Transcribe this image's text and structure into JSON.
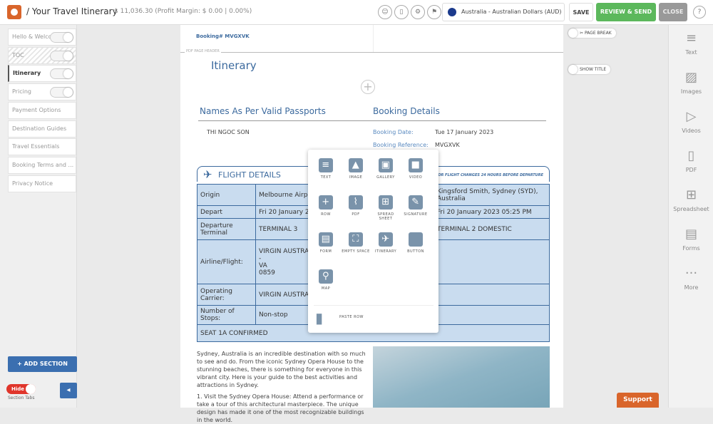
{
  "header": {
    "title": "/ Your Travel Itinerary",
    "price": "$ 11,036.30 (Profit Margin:  $ 0.00 | 0.00%)",
    "currency": "Australia - Australian Dollars (AUD)",
    "save": "SAVE",
    "review": "REVIEW & SEND",
    "close": "CLOSE",
    "help": "?"
  },
  "sidebar": {
    "items": [
      {
        "label": "Hello & Welcome"
      },
      {
        "label": "TOC"
      },
      {
        "label": "Itinerary"
      },
      {
        "label": "Pricing"
      },
      {
        "label": "Payment Options"
      },
      {
        "label": "Destination Guides"
      },
      {
        "label": "Travel Essentials"
      },
      {
        "label": "Booking Terms and ..."
      },
      {
        "label": "Privacy Notice"
      }
    ],
    "add_section": "+ ADD SECTION",
    "hide": "Hide",
    "section_tabs": "Section Tabs"
  },
  "page": {
    "booking_no": "Booking# MVGXVK",
    "pdf_header": "PDF PAGE HEADER",
    "title": "Itinerary",
    "names_heading": "Names As Per Valid Passports",
    "booking_heading": "Booking Details",
    "passenger": "THI NGOC SON",
    "booking_date_label": "Booking Date:",
    "booking_date": "Tue 17 January 2023",
    "booking_ref_label": "Booking Reference:",
    "booking_ref": "MVGXVK",
    "page_break": "PAGE BREAK",
    "show_title": "SHOW TITLE"
  },
  "flight": {
    "title": "FLIGHT DETAILS",
    "note": "FOR FLIGHT CHANGES 24 HOURS BEFORE DEPARTURE",
    "rows": [
      {
        "label": "Origin",
        "a": "Melbourne Airport, Melbourne (MEL)",
        "b": "Kingsford Smith, Sydney (SYD), Australia"
      },
      {
        "label": "Depart",
        "a": "Fri 20 January 2023",
        "b": "Fri 20 January 2023 05:25 PM"
      },
      {
        "label": "Departure Terminal",
        "a": "TERMINAL 3",
        "b": "TERMINAL 2 DOMESTIC"
      },
      {
        "label": "Airline/Flight:",
        "a": "VIRGIN AUSTRALIA",
        "a2": "-",
        "a3": "VA",
        "a4": "0859",
        "b": ""
      },
      {
        "label": "Operating Carrier:",
        "a": "VIRGIN AUSTRALIA",
        "b": ""
      },
      {
        "label": "Number of Stops:",
        "a": "Non-stop",
        "b": ""
      }
    ],
    "seat": "SEAT  1A CONFIRMED"
  },
  "popup": {
    "items": [
      {
        "label": "TEXT",
        "g": "≡"
      },
      {
        "label": "IMAGE",
        "g": "▲"
      },
      {
        "label": "GALLERY",
        "g": "▣"
      },
      {
        "label": "VIDEO",
        "g": "■"
      },
      {
        "label": "ROW",
        "g": "+"
      },
      {
        "label": "PDF",
        "g": "⌇"
      },
      {
        "label": "SPREAD SHEET",
        "g": "⊞"
      },
      {
        "label": "SIGNATURE",
        "g": "✎"
      },
      {
        "label": "FORM",
        "g": "▤"
      },
      {
        "label": "EMPTY SPACE",
        "g": "⛶"
      },
      {
        "label": "ITINERARY",
        "g": "✈"
      },
      {
        "label": "BUTTON",
        "g": ""
      },
      {
        "label": "MAP",
        "g": "⚲"
      }
    ],
    "paste": "PASTE ROW"
  },
  "content": {
    "p1": "Sydney, Australia is an incredible destination with so much to see and do. From the iconic Sydney Opera House to the stunning beaches, there is something for everyone in this vibrant city. Here is your guide to the best activities and attractions in Sydney.",
    "p2": "1. Visit the Sydney Opera House: Attend a performance or take a tour of this architectural masterpiece. The unique design has made it one of the most recognizable buildings in the world."
  },
  "toolbar": {
    "items": [
      {
        "label": "Text",
        "g": "≡"
      },
      {
        "label": "Images",
        "g": "▨"
      },
      {
        "label": "Videos",
        "g": "▷"
      },
      {
        "label": "PDF",
        "g": "▯"
      },
      {
        "label": "Spreadsheet",
        "g": "⊞"
      },
      {
        "label": "Forms",
        "g": "▤"
      },
      {
        "label": "More",
        "g": "···"
      }
    ]
  },
  "support": "Support"
}
